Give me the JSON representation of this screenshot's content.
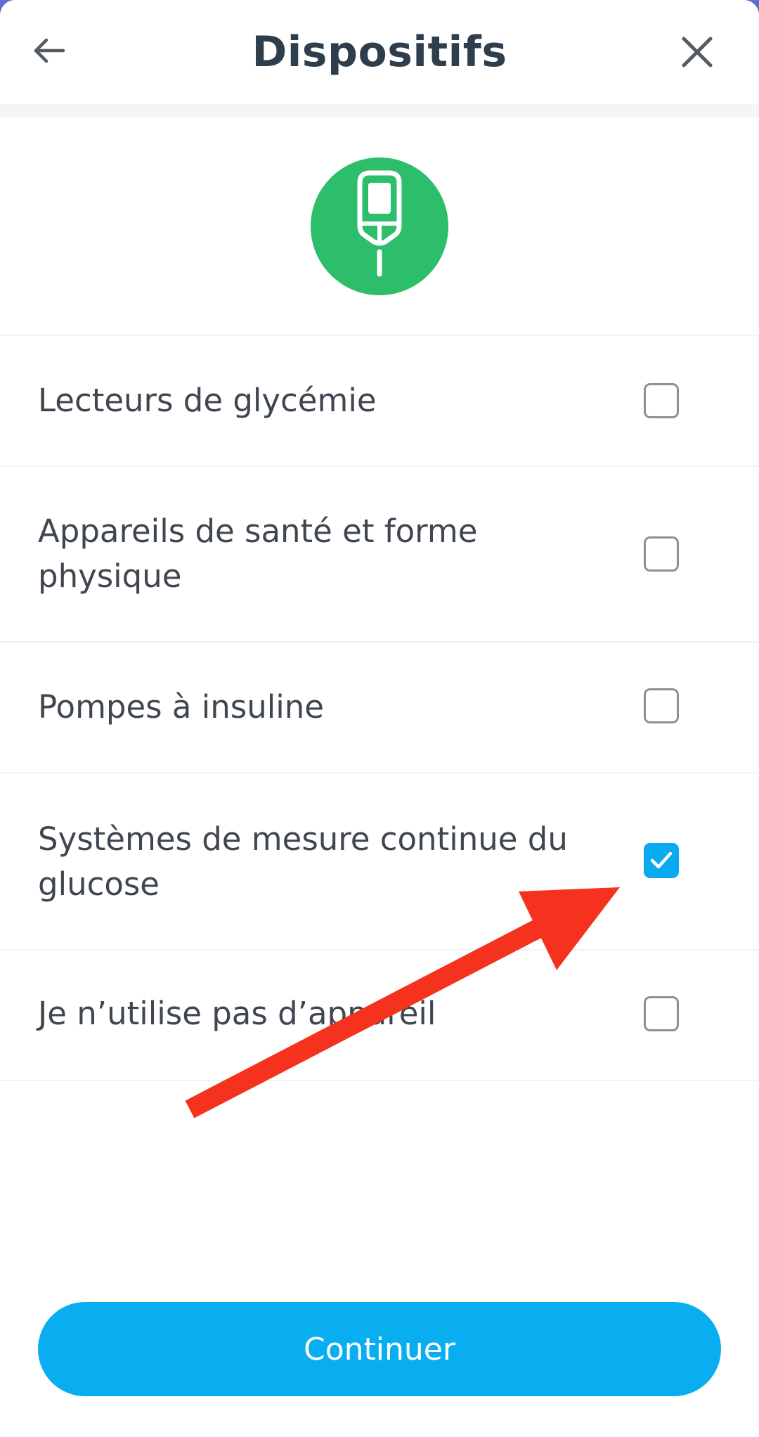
{
  "header": {
    "title": "Dispositifs",
    "back_icon": "arrow-left-icon",
    "close_icon": "close-icon"
  },
  "hero": {
    "icon": "glucose-meter-icon",
    "color": "#2dbe6c"
  },
  "options": [
    {
      "label": "Lecteurs de glycémie",
      "checked": false
    },
    {
      "label": "Appareils de santé et forme physique",
      "checked": false
    },
    {
      "label": "Pompes à insuline",
      "checked": false
    },
    {
      "label": "Systèmes de mesure continue du glucose",
      "checked": true
    },
    {
      "label": "Je n’utilise pas d’appareil",
      "checked": false
    }
  ],
  "footer": {
    "continue_label": "Continuer"
  },
  "colors": {
    "accent": "#09aef0",
    "annotation_arrow": "#f4321e"
  }
}
